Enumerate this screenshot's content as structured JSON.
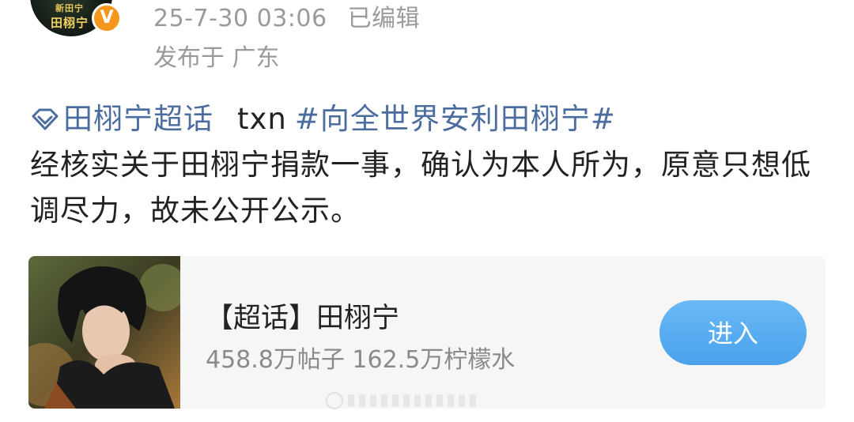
{
  "header": {
    "avatar_text": "新田宁 田栩宁",
    "verified_glyph": "V",
    "timestamp": "25-7-30 03:06",
    "edited_label": "已编辑",
    "location": "发布于 广东"
  },
  "post": {
    "supertopic_link": "田栩宁超话",
    "plain_text": "txn",
    "hashtag": "#向全世界安利田栩宁#",
    "content": "经核实关于田栩宁捐款一事，确认为本人所为，原意只想低调尽力，故未公开公示。",
    "tag_icon": "supertopic-diamond-icon"
  },
  "card": {
    "title": "【超话】田栩宁",
    "stats": "458.8万帖子 162.5万柠檬水",
    "enter_label": "进入",
    "button_color": "#4aa2ec"
  },
  "colors": {
    "link": "#4b6c9e",
    "meta": "#9a9a9a",
    "badge": "#f7961c"
  }
}
